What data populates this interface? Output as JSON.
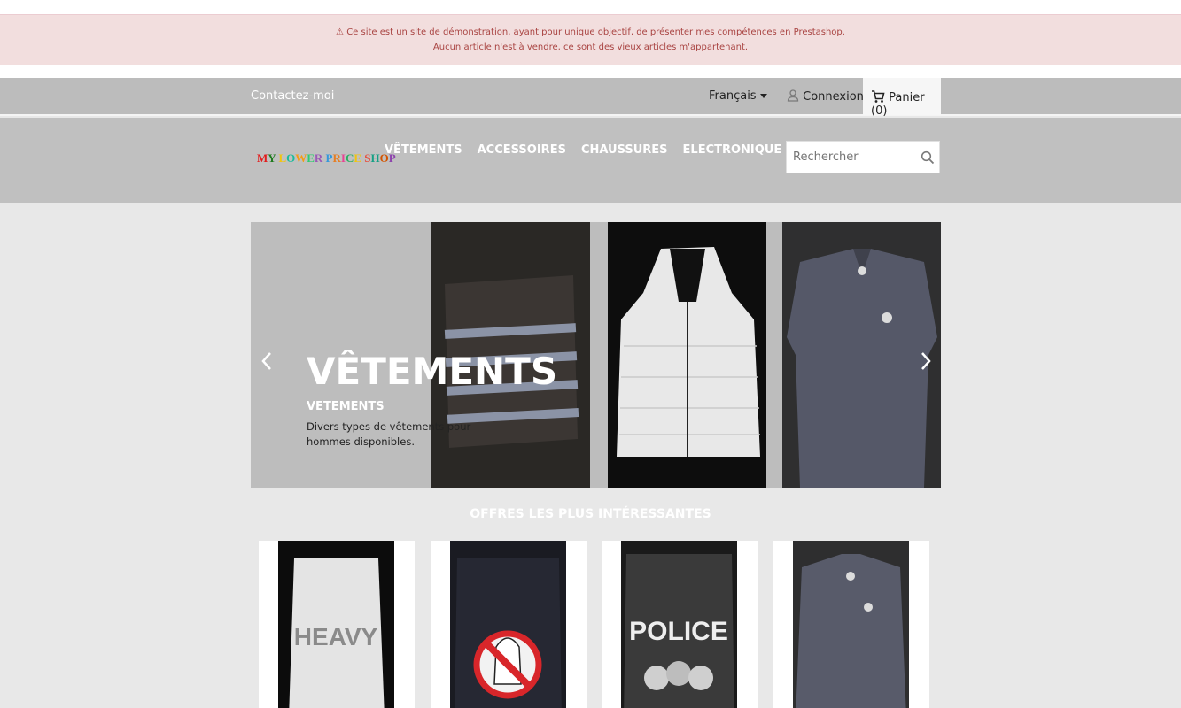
{
  "notice": {
    "line1": "⚠ Ce site est un site de démonstration, ayant pour unique objectif, de présenter mes compétences en Prestashop.",
    "line2": "Aucun article n'est à vendre, ce sont des vieux articles m'appartenant."
  },
  "nav": {
    "contact": "Contactez-moi",
    "language": "Français",
    "login": "Connexion",
    "cart": "Panier (0)"
  },
  "header": {
    "logo_letters": [
      "M",
      "Y",
      " ",
      "L",
      "O",
      "W",
      "E",
      "R",
      " ",
      "P",
      "R",
      "I",
      "C",
      "E",
      " ",
      "S",
      "H",
      "O",
      "P"
    ],
    "menu": [
      "VÊTEMENTS",
      "ACCESSOIRES",
      "CHAUSSURES",
      "ELECTRONIQUE"
    ],
    "search_placeholder": "Rechercher"
  },
  "slider": {
    "title": "VÊTEMENTS",
    "subtitle": "VETEMENTS",
    "description": "Divers types de vêtements pour hommes disponibles."
  },
  "section": {
    "title": "OFFRES LES PLUS INTÉRESSANTES"
  },
  "products": [
    {
      "print": "HEAVY"
    },
    {
      "print": ""
    },
    {
      "print": "POLICE"
    },
    {
      "print": ""
    }
  ],
  "colors": {
    "notice_bg": "#f2dede",
    "notice_text": "#a94442",
    "navbar": "#bcbcbc",
    "header": "#c0c0c0",
    "page_bg": "#e8e8e8"
  }
}
